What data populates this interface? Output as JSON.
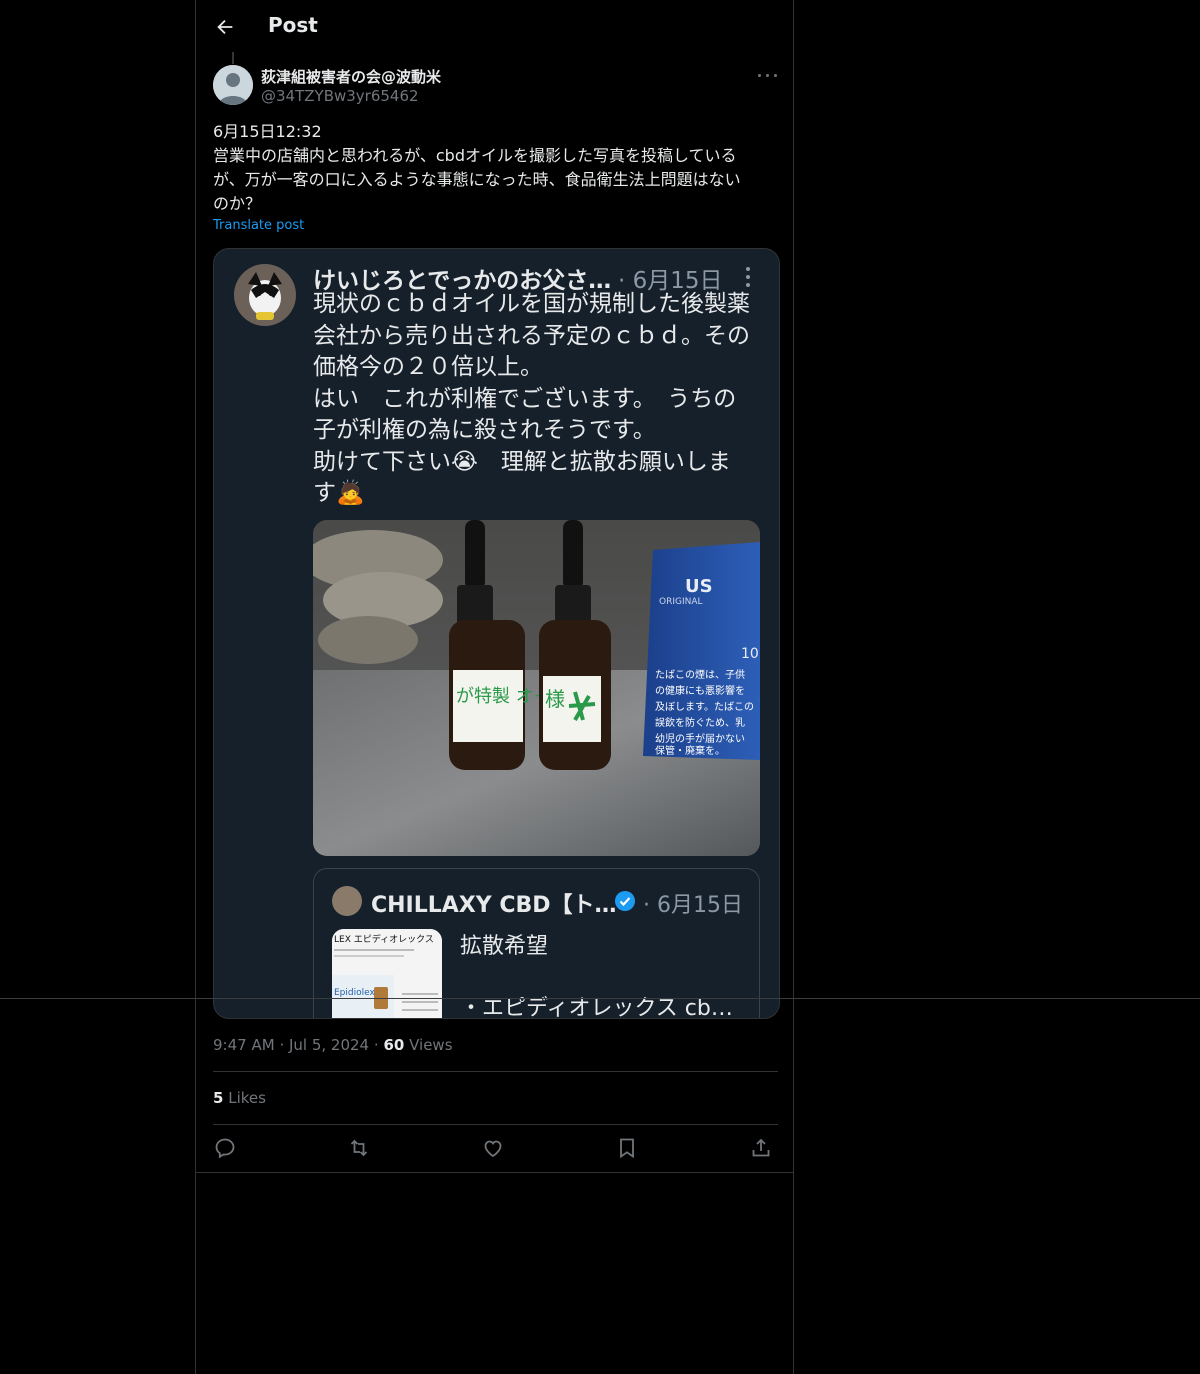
{
  "header": {
    "title": "Post"
  },
  "post": {
    "author_name": "荻津組被害者の会@波動米",
    "author_handle": "@34TZYBw3yr65462",
    "body_lines": [
      "6月15日12:32",
      "営業中の店舗内と思われるが、cbdオイルを撮影した写真を投稿している",
      "が、万が一客の口に入るような事態になった時、食品衛生法上問題はない",
      "のか？"
    ],
    "translate_label": "Translate post",
    "time": "9:47 AM",
    "date": "Jul 5, 2024",
    "views_count": "60",
    "views_label": "Views",
    "likes_count": "5",
    "likes_label": "Likes"
  },
  "screenshot": {
    "author": "けいじろとでっかのお父さ…",
    "date": "· 6月15日",
    "text_lines": [
      "現状のｃｂｄオイルを国が規制した後製薬",
      "会社から売り出される予定のｃｂｄ。その",
      "価格今の２０倍以上。",
      "はい　これが利権でございます。　うちの",
      "子が利権の為に殺されそうです。",
      "助けて下さい😭　理解と拡散お願いしま",
      "す🙇"
    ],
    "photo_label_left": "が特製 オイル",
    "photo_label_right": "様",
    "box_brand": "US",
    "box_sub": "ORIGINAL",
    "box_num": "10",
    "box_warning": [
      "たばこの煙は、子供",
      "の健康にも悪影響を",
      "及ぼします。たばこの",
      "誤飲を防ぐため、乳",
      "幼児の手が届かない",
      "保管・廃棄を。"
    ],
    "quoted": {
      "name": "CHILLAXY CBD【ト…",
      "date": "· 6月15日",
      "line1": "拡散希望",
      "line2": "・エピディオレックス cb…",
      "thumb_title": "LEX エピディオレックス",
      "thumb_brand": "Epidiolex"
    }
  },
  "colors": {
    "accent": "#1d9bf0",
    "background": "#000000",
    "muted": "#71767b"
  }
}
